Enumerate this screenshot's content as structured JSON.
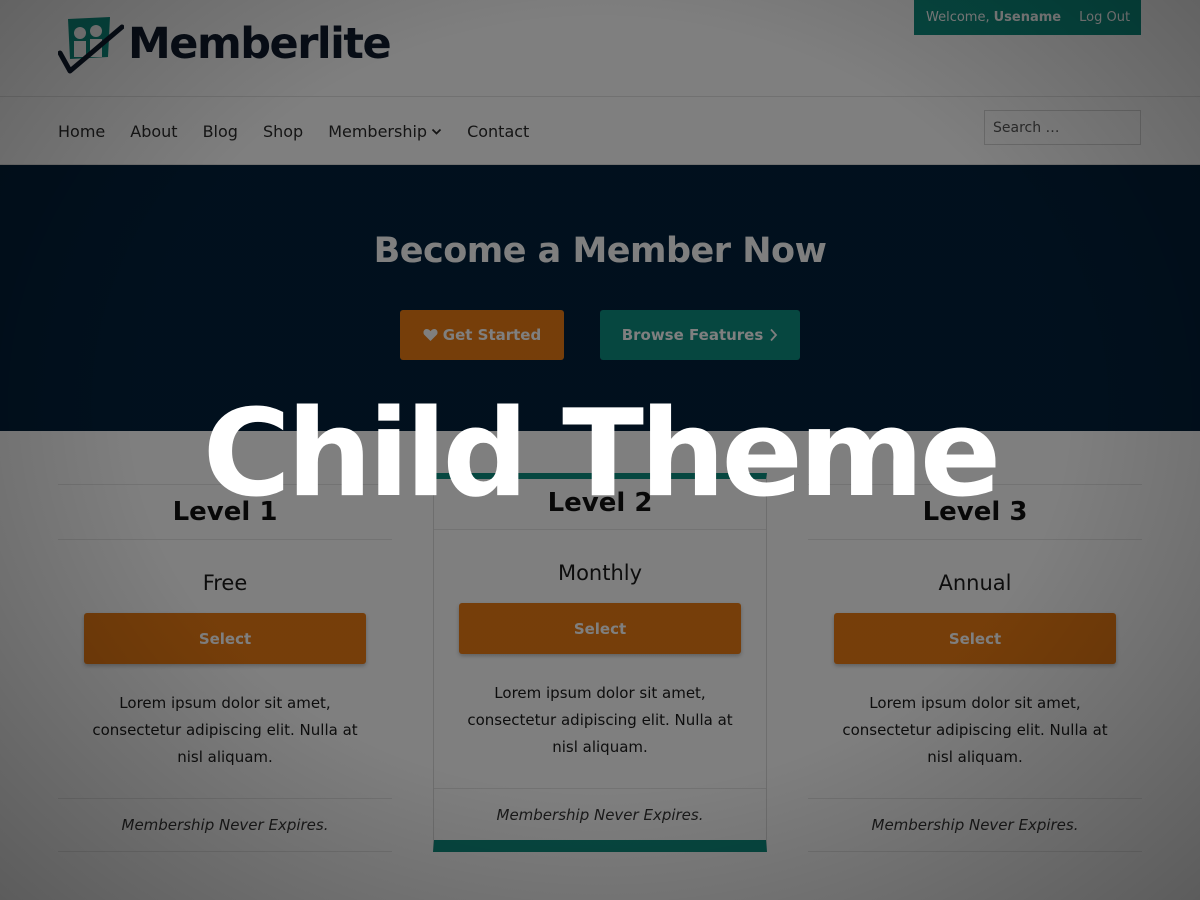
{
  "header": {
    "site_title": "Memberlite",
    "welcome": "Welcome,",
    "username": "Usename",
    "logout": "Log Out"
  },
  "nav": {
    "items": [
      "Home",
      "About",
      "Blog",
      "Shop",
      "Membership",
      "Contact"
    ],
    "search_placeholder": "Search …"
  },
  "hero": {
    "heading": "Become a Member Now",
    "primary_button": "Get Started",
    "secondary_button": "Browse Features"
  },
  "levels": [
    {
      "name": "Level 1",
      "price": "Free",
      "button": "Select",
      "description": "Lorem ipsum dolor sit amet, consectetur adipiscing elit. Nulla at nisl aliquam.",
      "footer": "Membership Never Expires."
    },
    {
      "name": "Level 2",
      "price": "Monthly",
      "button": "Select",
      "description": "Lorem ipsum dolor sit amet, consectetur adipiscing elit. Nulla at nisl aliquam.",
      "footer": "Membership Never Expires."
    },
    {
      "name": "Level 3",
      "price": "Annual",
      "button": "Select",
      "description": "Lorem ipsum dolor sit amet, consectetur adipiscing elit. Nulla at nisl aliquam.",
      "footer": "Membership Never Expires."
    }
  ],
  "overlay": {
    "title": "Child Theme"
  },
  "icons": {
    "logo": "memberlite-logo-icon",
    "nav_dropdown": "chevron-down-icon",
    "get_started": "heart-icon",
    "browse_features": "chevron-right-icon"
  },
  "colors": {
    "accent_teal": "#0c8e80",
    "accent_orange": "#ec7c13",
    "hero_navy": "#02203b",
    "title_navy": "#0f1a2c"
  }
}
